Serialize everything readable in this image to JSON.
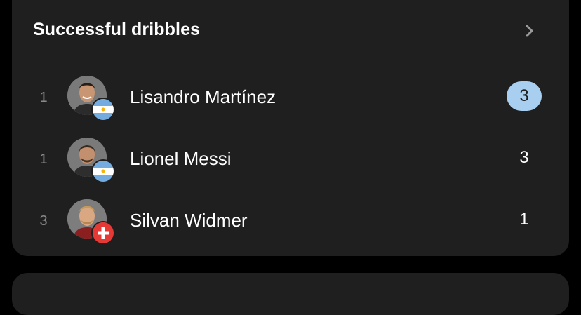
{
  "card": {
    "title": "Successful dribbles",
    "more_icon": "chevron-right-icon"
  },
  "players": [
    {
      "rank": "1",
      "name": "Lisandro Martínez",
      "value": "3",
      "highlighted": true,
      "flag": "argentina-flag-icon"
    },
    {
      "rank": "1",
      "name": "Lionel Messi",
      "value": "3",
      "highlighted": false,
      "flag": "argentina-flag-icon"
    },
    {
      "rank": "3",
      "name": "Silvan Widmer",
      "value": "1",
      "highlighted": false,
      "flag": "switzerland-flag-icon"
    }
  ],
  "colors": {
    "background": "#000000",
    "card": "#1f1f1f",
    "highlight": "#a8cff0",
    "rank_text": "#8a8a8a",
    "argentina_blue": "#74acdf",
    "switzerland_red": "#e53935"
  }
}
